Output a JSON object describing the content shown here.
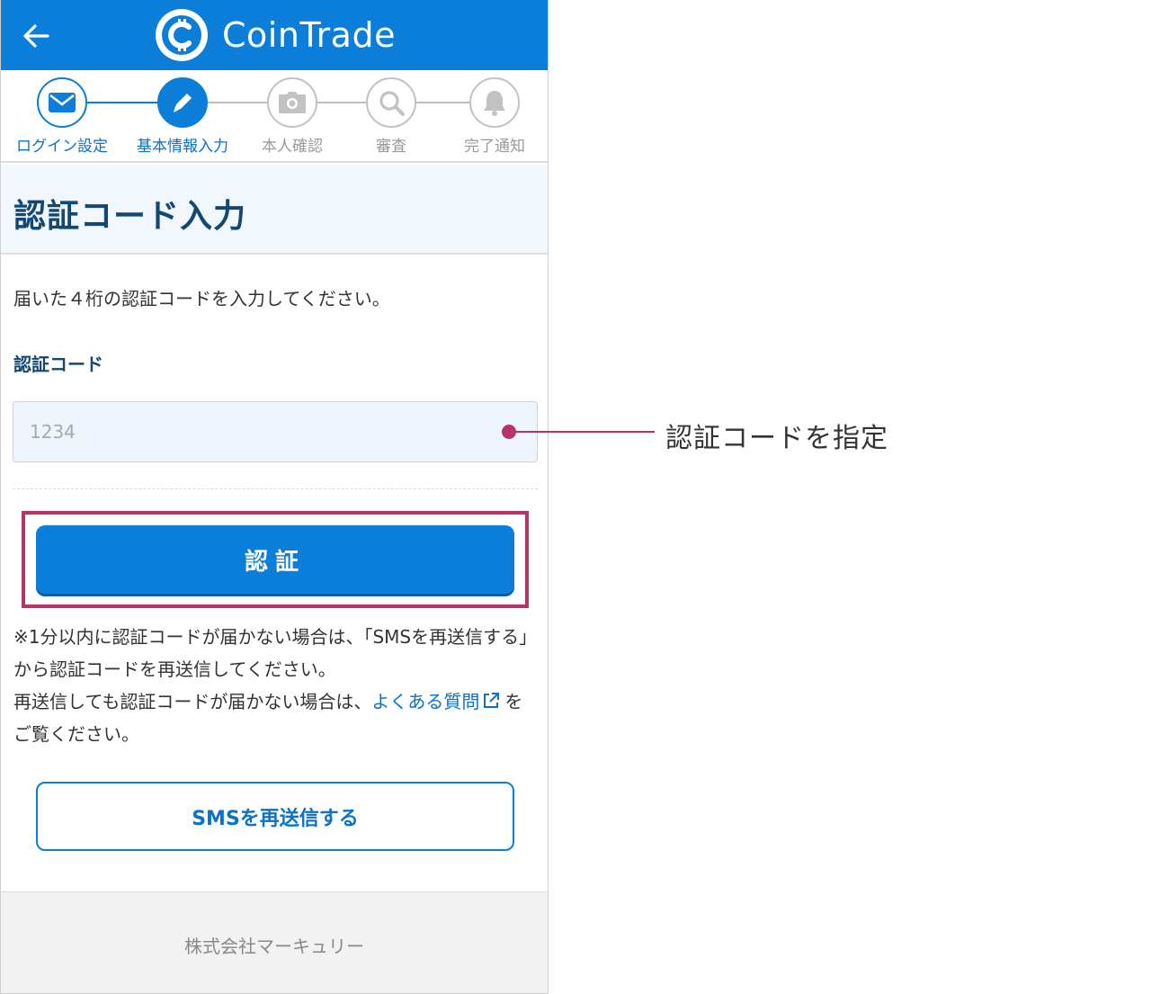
{
  "header": {
    "brand": "CoinTrade"
  },
  "steps": [
    {
      "label": "ログイン設定",
      "icon": "envelope-icon",
      "state": "done"
    },
    {
      "label": "基本情報入力",
      "icon": "pencil-icon",
      "state": "current"
    },
    {
      "label": "本人確認",
      "icon": "camera-icon",
      "state": "pending"
    },
    {
      "label": "審査",
      "icon": "magnifier-icon",
      "state": "pending"
    },
    {
      "label": "完了通知",
      "icon": "bell-icon",
      "state": "pending"
    }
  ],
  "page": {
    "title": "認証コード入力",
    "instruction": "届いた４桁の認証コードを入力してください。",
    "code_label": "認証コード",
    "code_placeholder": "1234",
    "code_value": "",
    "verify_label": "認証",
    "note_line1": "※1分以内に認証コードが届かない場合は、「SMSを再送信する」から認証コードを再送信してください。",
    "note_line2_prefix": "再送信しても認証コードが届かない場合は、",
    "faq_link": "よくある質問",
    "note_line2_suffix": "をご覧ください。",
    "resend_label": "SMSを再送信する"
  },
  "footer": {
    "company": "株式会社マーキュリー"
  },
  "annotation": {
    "text": "認証コードを指定"
  },
  "colors": {
    "brand_blue": "#0a7ed8",
    "title_navy": "#134873",
    "highlight": "#b8336a",
    "inactive_gray": "#c2c2c2"
  }
}
